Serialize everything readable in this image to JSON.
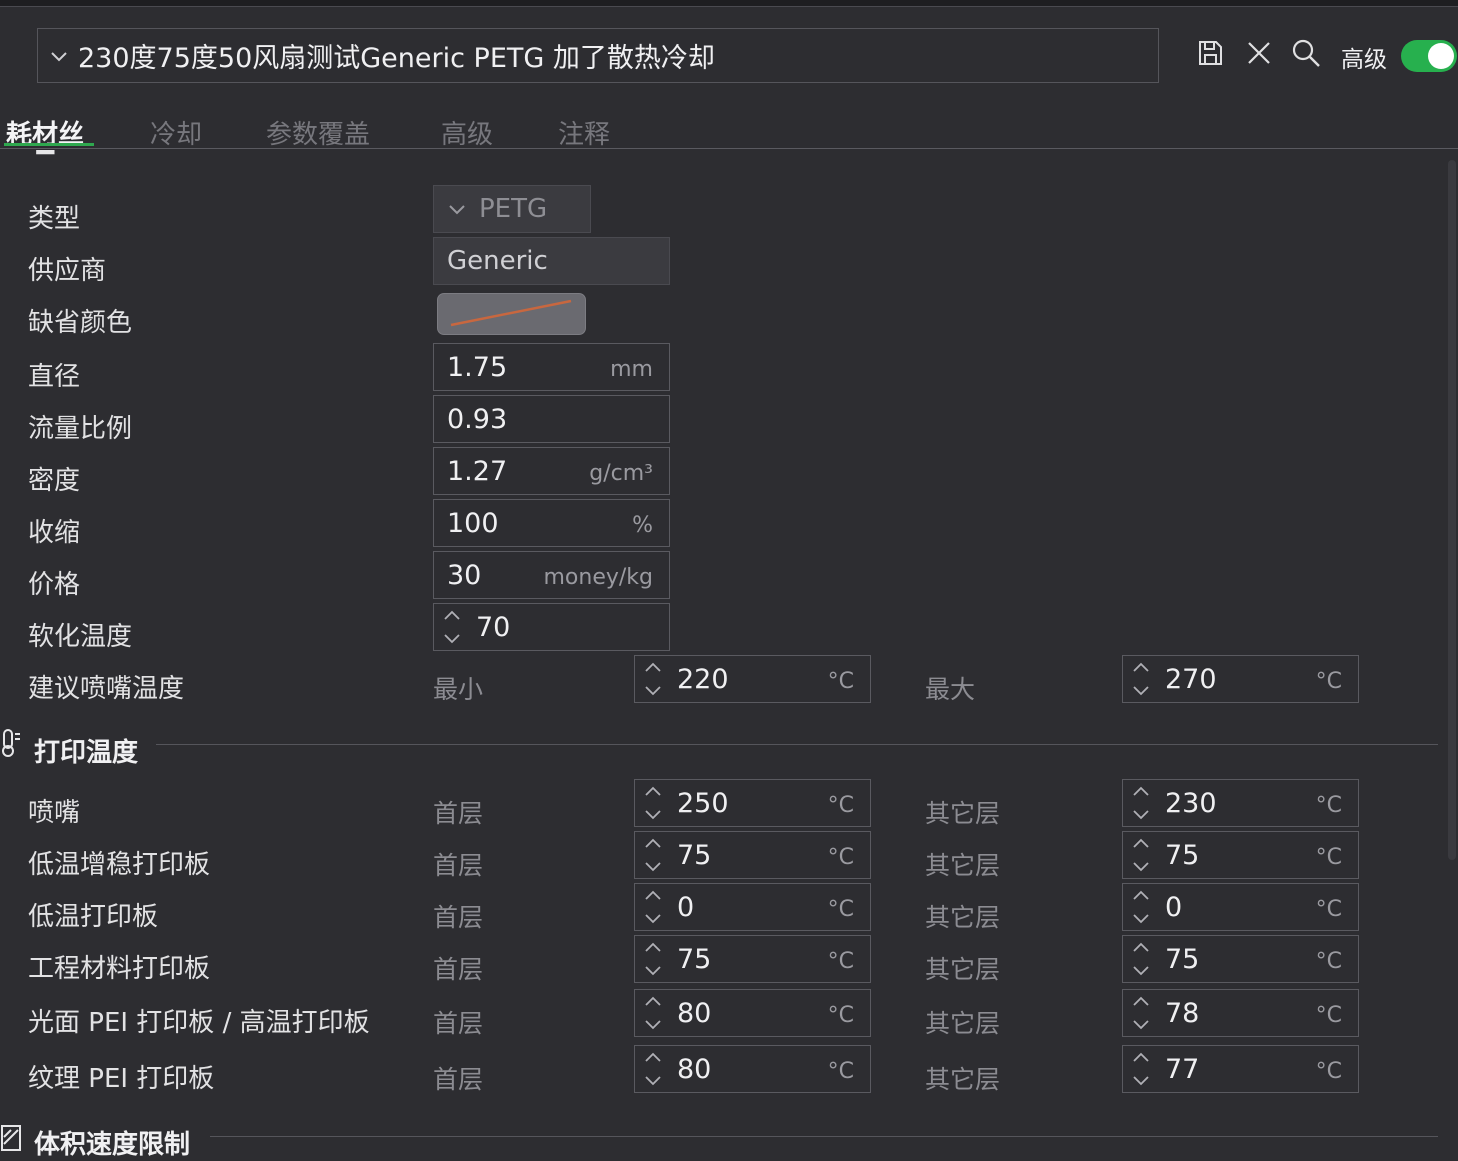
{
  "header": {
    "preset_title": "230度75度50风扇测试Generic PETG 加了散热冷却",
    "advanced_label": "高级",
    "advanced_toggle": "on",
    "icons": [
      "chevron-down-icon",
      "save-icon",
      "close-icon",
      "search-icon"
    ]
  },
  "tabs": [
    {
      "label": "耗材丝",
      "active": true
    },
    {
      "label": "冷却",
      "active": false
    },
    {
      "label": "参数覆盖",
      "active": false
    },
    {
      "label": "高级",
      "active": false
    },
    {
      "label": "注释",
      "active": false
    }
  ],
  "filament": {
    "type_label": "类型",
    "type_value": "PETG",
    "vendor_label": "供应商",
    "vendor_value": "Generic",
    "color_label": "缺省颜色",
    "diameter_label": "直径",
    "diameter_value": "1.75",
    "diameter_unit": "mm",
    "flow_label": "流量比例",
    "flow_value": "0.93",
    "density_label": "密度",
    "density_value": "1.27",
    "density_unit": "g/cm³",
    "shrink_label": "收缩",
    "shrink_value": "100",
    "shrink_unit": "%",
    "price_label": "价格",
    "price_value": "30",
    "price_unit": "money/kg",
    "soften_label": "软化温度",
    "soften_value": "70",
    "nozzle_range_label": "建议喷嘴温度",
    "min_label": "最小",
    "min_value": "220",
    "max_label": "最大",
    "max_value": "270",
    "temp_unit": "°C"
  },
  "print_temp": {
    "section_title": "打印温度",
    "first_layer_label": "首层",
    "other_layers_label": "其它层",
    "unit": "°C",
    "rows": [
      {
        "label": "喷嘴",
        "first": "250",
        "other": "230"
      },
      {
        "label": "低温增稳打印板",
        "first": "75",
        "other": "75"
      },
      {
        "label": "低温打印板",
        "first": "0",
        "other": "0"
      },
      {
        "label": "工程材料打印板",
        "first": "75",
        "other": "75"
      },
      {
        "label": "光面 PEI 打印板 / 高温打印板",
        "first": "80",
        "other": "78"
      },
      {
        "label": "纹理 PEI 打印板",
        "first": "80",
        "other": "77"
      }
    ]
  },
  "volumetric": {
    "section_title": "体积速度限制"
  },
  "colors": {
    "background": "#2d2d31",
    "accent_green": "#27b04e",
    "filament_color_line": "#c8673f"
  }
}
